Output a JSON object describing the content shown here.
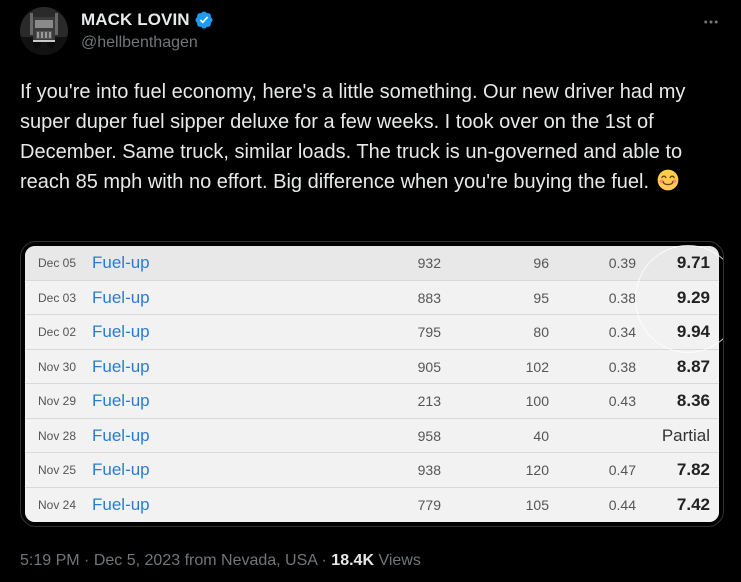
{
  "user": {
    "display_name": "MACK LOVIN",
    "handle": "@hellbenthagen",
    "verified": true
  },
  "tweet": {
    "text": "If you're into fuel economy, here's a little something.  Our new driver had my super duper fuel sipper deluxe for a few weeks. I took over on the 1st of December. Same truck, similar loads. The truck is un-governed and able to reach 85 mph with no effort. Big difference when you're buying the fuel.",
    "emoji": "smiling-face-with-smiling-eyes"
  },
  "fuel_table": {
    "rows": [
      {
        "date": "Dec 05",
        "link": "Fuel-up",
        "miles": "932",
        "gallons": "96",
        "cost_per_mile": "0.39",
        "mpg": "9.71"
      },
      {
        "date": "Dec 03",
        "link": "Fuel-up",
        "miles": "883",
        "gallons": "95",
        "cost_per_mile": "0.38",
        "mpg": "9.29"
      },
      {
        "date": "Dec 02",
        "link": "Fuel-up",
        "miles": "795",
        "gallons": "80",
        "cost_per_mile": "0.34",
        "mpg": "9.94"
      },
      {
        "date": "Nov 30",
        "link": "Fuel-up",
        "miles": "905",
        "gallons": "102",
        "cost_per_mile": "0.38",
        "mpg": "8.87"
      },
      {
        "date": "Nov 29",
        "link": "Fuel-up",
        "miles": "213",
        "gallons": "100",
        "cost_per_mile": "0.43",
        "mpg": "8.36"
      },
      {
        "date": "Nov 28",
        "link": "Fuel-up",
        "miles": "958",
        "gallons": "40",
        "cost_per_mile": "",
        "mpg": "Partial"
      },
      {
        "date": "Nov 25",
        "link": "Fuel-up",
        "miles": "938",
        "gallons": "120",
        "cost_per_mile": "0.47",
        "mpg": "7.82"
      },
      {
        "date": "Nov 24",
        "link": "Fuel-up",
        "miles": "779",
        "gallons": "105",
        "cost_per_mile": "0.44",
        "mpg": "7.42"
      }
    ]
  },
  "meta": {
    "time": "5:19 PM",
    "separator": "·",
    "date": "Dec 5, 2023",
    "location": "from Nevada, USA",
    "views_count": "18.4K",
    "views_label": "Views"
  },
  "colors": {
    "background": "#000000",
    "text": "#e7e9ea",
    "secondary": "#71767b",
    "verified": "#1d9bf0",
    "link_blue": "#2b7bd6"
  },
  "icons": {
    "verified": "verified-badge-icon",
    "more": "more-dots-icon"
  }
}
